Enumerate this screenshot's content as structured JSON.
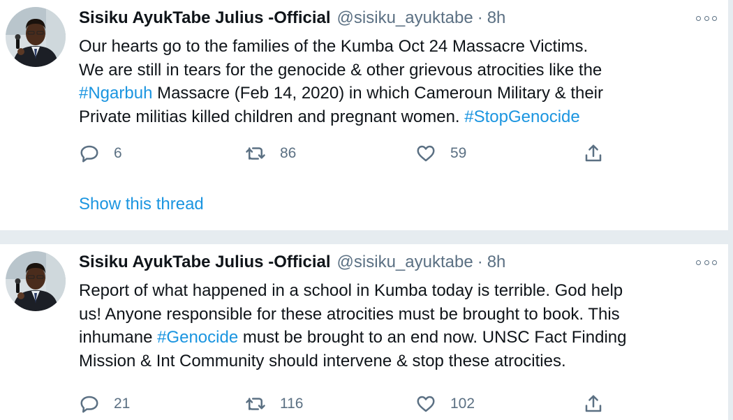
{
  "colors": {
    "link": "#1b95e0",
    "secondary_text": "#5b7083",
    "primary_text": "#0f1419",
    "separator": "#e6ecf0"
  },
  "tweets": [
    {
      "author": {
        "name": "Sisiku AyukTabe Julius -Official",
        "handle": "@sisiku_ayuktabe",
        "separator": "·",
        "time": "8h"
      },
      "lines": [
        [
          {
            "text": "Our hearts go to the families of the Kumba Oct 24 Massacre Victims."
          }
        ],
        [
          {
            "text": "We are still in tears for the genocide & other grievous atrocities like the"
          }
        ],
        [
          {
            "text": "#Ngarbuh",
            "link": true
          },
          {
            "text": " Massacre (Feb 14, 2020) in which Cameroun Military & their"
          }
        ],
        [
          {
            "text": "Private militias killed children and pregnant women. "
          },
          {
            "text": "#StopGenocide",
            "link": true
          }
        ]
      ],
      "actions": {
        "reply_count": "6",
        "retweet_count": "86",
        "like_count": "59"
      },
      "show_thread": "Show this thread"
    },
    {
      "author": {
        "name": "Sisiku AyukTabe Julius -Official",
        "handle": "@sisiku_ayuktabe",
        "separator": "·",
        "time": "8h"
      },
      "lines": [
        [
          {
            "text": "Report of what happened in a school in Kumba today is terrible. God help"
          }
        ],
        [
          {
            "text": "us! Anyone responsible for these atrocities must be brought to book. This"
          }
        ],
        [
          {
            "text": "inhumane "
          },
          {
            "text": "#Genocide",
            "link": true
          },
          {
            "text": " must be brought to an end now. UNSC Fact Finding"
          }
        ],
        [
          {
            "text": "Mission & Int Community should intervene & stop these atrocities."
          }
        ]
      ],
      "actions": {
        "reply_count": "21",
        "retweet_count": "116",
        "like_count": "102"
      }
    }
  ]
}
